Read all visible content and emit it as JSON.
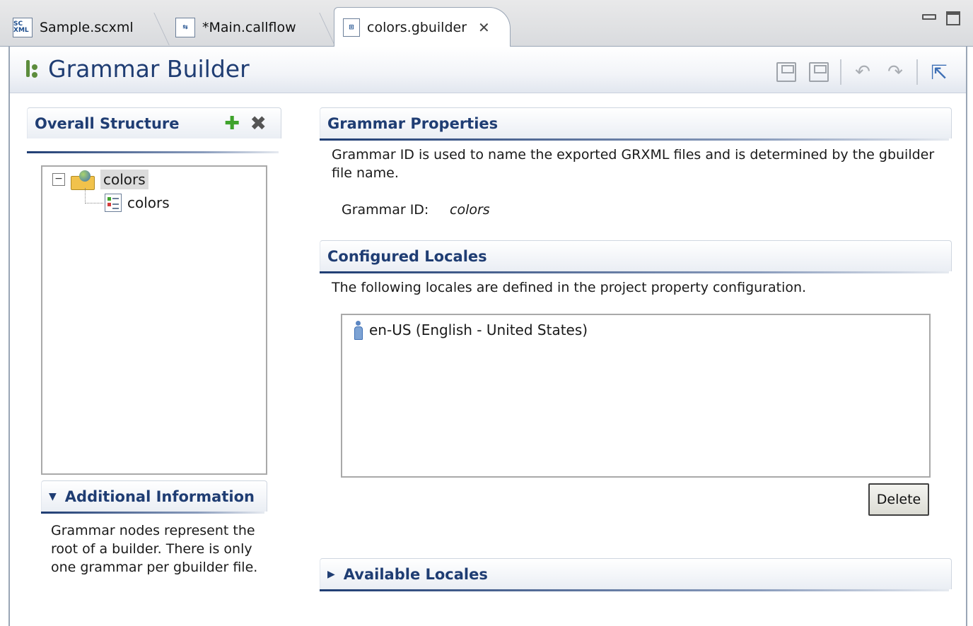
{
  "tabs": [
    {
      "label": "Sample.scxml",
      "icon": "scxml-file-icon",
      "icon_text": "SC XML"
    },
    {
      "label": "*Main.callflow",
      "icon": "callflow-file-icon"
    },
    {
      "label": "colors.gbuilder",
      "icon": "gbuilder-file-icon",
      "active": true,
      "close_glyph": "✕"
    }
  ],
  "editor": {
    "title": "Grammar Builder",
    "toolbar": [
      "save-icon",
      "save-all-icon",
      "undo-icon",
      "redo-icon",
      "export-icon"
    ]
  },
  "overall_structure": {
    "title": "Overall Structure",
    "tree": [
      {
        "label": "colors",
        "icon": "grammar-folder-icon",
        "expanded": true,
        "selected": true,
        "children": [
          {
            "label": "colors",
            "icon": "rule-icon"
          }
        ]
      }
    ]
  },
  "additional_info": {
    "title": "Additional Information",
    "text": "Grammar nodes represent the root of a builder. There is only one grammar per gbuilder file."
  },
  "grammar_properties": {
    "title": "Grammar Properties",
    "description": "Grammar ID is used to name the exported GRXML files and is determined by the gbuilder file name.",
    "id_label": "Grammar ID:",
    "id_value": "colors"
  },
  "configured_locales": {
    "title": "Configured Locales",
    "description": "The following locales are defined in the project property configuration.",
    "items": [
      "en-US (English - United States)"
    ],
    "delete_label": "Delete"
  },
  "available_locales": {
    "title": "Available Locales",
    "expanded": false
  },
  "colors": {
    "title_blue": "#1f3d73",
    "add_green": "#3fa32c"
  }
}
